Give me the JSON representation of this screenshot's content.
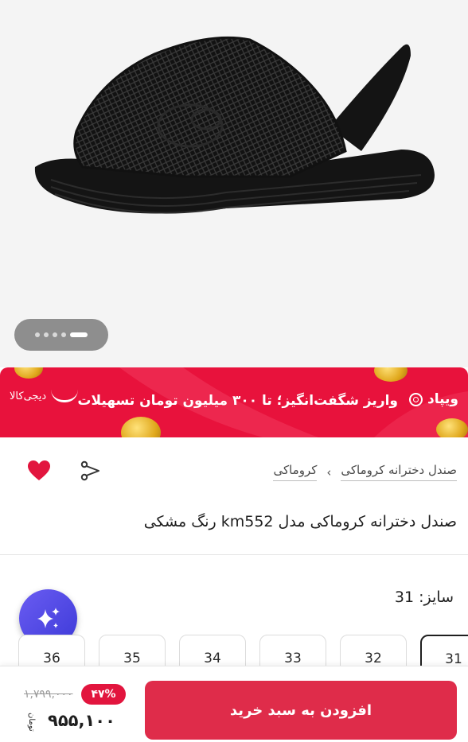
{
  "gallery": {
    "slide_count": 5,
    "active_slide": 5
  },
  "banner": {
    "brand": "ویپاد",
    "headline": "واریز شگفت‌انگیز؛ تا ۳۰۰ میلیون تومان تسهیلات",
    "partner": "دیجی‌کالا"
  },
  "breadcrumb": {
    "items": [
      "کروماکی",
      "صندل دخترانه کروماکی"
    ]
  },
  "product": {
    "title": "صندل دخترانه کروماکی مدل km552 رنگ مشکی"
  },
  "size": {
    "label": "سایز: 31",
    "options": [
      "31",
      "32",
      "33",
      "34",
      "35",
      "36"
    ],
    "selected": "31"
  },
  "purchase": {
    "add_to_cart": "افزودن به سبد خرید",
    "old_price": "۱,۷۹۹,۰۰۰",
    "discount": "۴۷%",
    "price": "۹۵۵,۱۰۰",
    "currency": "تومان"
  },
  "colors": {
    "accent": "#e2153e",
    "button": "#df2c4a",
    "ai_button": "#5048e5"
  },
  "icons": {
    "share": "share-icon",
    "favorite": "heart-icon",
    "ai": "sparkle-icon"
  }
}
